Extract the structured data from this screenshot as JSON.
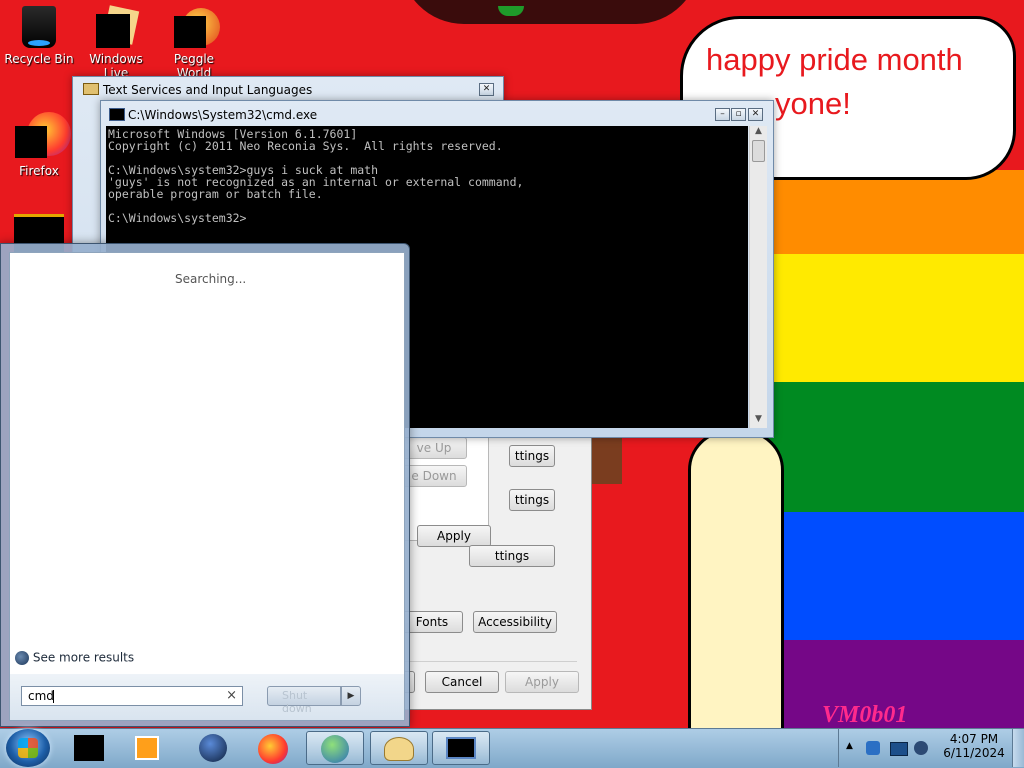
{
  "desktop": {
    "icons": [
      {
        "label": "Recycle Bin"
      },
      {
        "label": "Windows Live"
      },
      {
        "label": "Peggle World"
      },
      {
        "label": "Firefox"
      }
    ],
    "speech_bubble": {
      "line1": "happy pride month",
      "line2": "yone!"
    },
    "signature": "VM0b01",
    "colors": {
      "red": "#e8191e",
      "orange": "#ff8c00",
      "yellow": "#ffea00",
      "green": "#008a21",
      "blue": "#004dff",
      "purple": "#750787"
    }
  },
  "text_services": {
    "title": "Text Services and Input Languages",
    "move_up": "ve Up",
    "move_down": "e Down",
    "settings_label": "ttings",
    "apply": "Apply",
    "fonts": "Fonts",
    "accessibility": "Accessibility",
    "cancel": "Cancel",
    "apply_bottom": "Apply"
  },
  "cmd": {
    "title": "C:\\Windows\\System32\\cmd.exe",
    "lines": [
      "Microsoft Windows [Version 6.1.7601]",
      "Copyright (c) 2011 Neo Reconia Sys.  All rights reserved.",
      "",
      "C:\\Windows\\system32>guys i suck at math",
      "'guys' is not recognized as an internal or external command,",
      "operable program or batch file.",
      "",
      "C:\\Windows\\system32>"
    ]
  },
  "start_menu": {
    "status": "Searching...",
    "see_more": "See more results",
    "search_value": "cmd",
    "clear": "×",
    "shutdown_label": "Shut down"
  },
  "taskbar": {
    "time": "4:07 PM",
    "date": "6/11/2024"
  }
}
